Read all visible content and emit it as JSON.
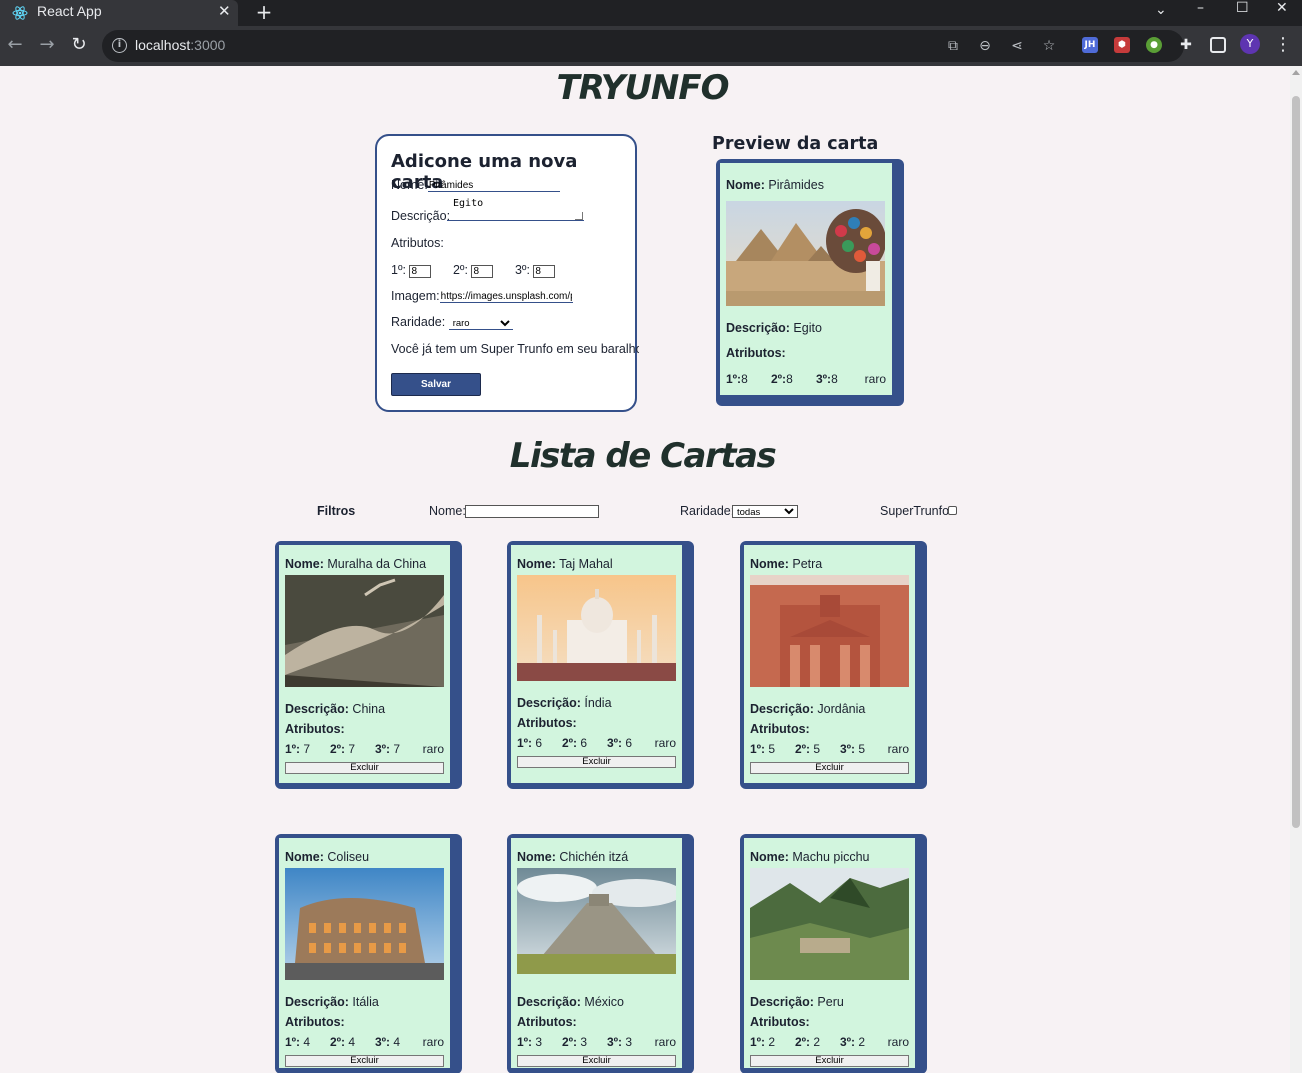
{
  "browser": {
    "tab_title": "React App",
    "url_host": "localhost",
    "url_port": ":3000",
    "avatar_letter": "Y",
    "ext_jh": "JH"
  },
  "app": {
    "logo": "TRYUNFO",
    "list_title": "Lista de Cartas"
  },
  "form": {
    "title": "Adicone uma nova carta",
    "name_label": "Nome:",
    "name_value": "Pirâmides",
    "desc_label": "Descrição:",
    "desc_value": "Egito",
    "attrs_label": "Atributos:",
    "attr1_label": "1º:",
    "attr1_value": "8",
    "attr2_label": "2º:",
    "attr2_value": "8",
    "attr3_label": "3º:",
    "attr3_value": "8",
    "image_label": "Imagem:",
    "image_value": "https://images.unsplash.com/p",
    "rarity_label": "Raridade:",
    "rarity_value": "raro",
    "trunfo_msg": "Você já tem um Super Trunfo em seu baralho",
    "save_label": "Salvar"
  },
  "preview": {
    "title": "Preview da carta",
    "name_key": "Nome:",
    "name": "Pirâmides",
    "desc_key": "Descrição:",
    "desc": "Egito",
    "attrs_key": "Atributos:",
    "a1_key": "1º:",
    "a1": "8",
    "a2_key": "2º:",
    "a2": "8",
    "a3_key": "3º:",
    "a3": "8",
    "rarity": "raro"
  },
  "filters": {
    "title": "Filtros",
    "name_label": "Nome:",
    "rarity_label": "Raridade:",
    "rarity_value": "todas",
    "trunfo_label": "SuperTrunfo"
  },
  "cards": [
    {
      "name": "Muralha da China",
      "desc": "China",
      "a1": "7",
      "a2": "7",
      "a3": "7",
      "rarity": "raro",
      "img": "wall"
    },
    {
      "name": "Taj Mahal",
      "desc": "Índia",
      "a1": "6",
      "a2": "6",
      "a3": "6",
      "rarity": "raro",
      "img": "taj"
    },
    {
      "name": "Petra",
      "desc": "Jordânia",
      "a1": "5",
      "a2": "5",
      "a3": "5",
      "rarity": "raro",
      "img": "petra"
    },
    {
      "name": "Coliseu",
      "desc": "Itália",
      "a1": "4",
      "a2": "4",
      "a3": "4",
      "rarity": "raro",
      "img": "colosseum"
    },
    {
      "name": "Chichén itzá",
      "desc": "México",
      "a1": "3",
      "a2": "3",
      "a3": "3",
      "rarity": "raro",
      "img": "chichen"
    },
    {
      "name": "Machu picchu",
      "desc": "Peru",
      "a1": "2",
      "a2": "2",
      "a3": "2",
      "rarity": "raro",
      "img": "machu"
    }
  ],
  "card_labels": {
    "name_key": "Nome:",
    "desc_key": "Descrição:",
    "attrs_key": "Atributos:",
    "a1_key": "1º:",
    "a2_key": "2º:",
    "a3_key": "3º:",
    "delete_label": "Excluir"
  }
}
